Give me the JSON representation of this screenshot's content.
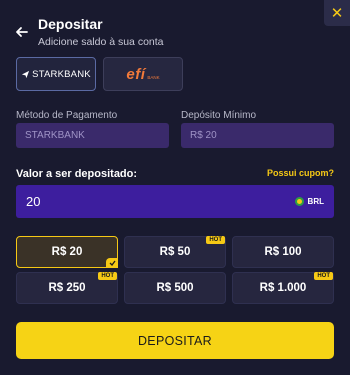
{
  "header": {
    "title": "Depositar",
    "subtitle": "Adicione saldo à sua conta",
    "close_label": "✕"
  },
  "methods": [
    {
      "name": "STARKBANK",
      "selected": true
    },
    {
      "name": "efí",
      "sub": "BANK",
      "selected": false
    }
  ],
  "payment": {
    "method_label": "Método de Pagamento",
    "method_value": "STARKBANK",
    "min_label": "Depósito Mínimo",
    "min_value": "R$ 20"
  },
  "amount": {
    "label": "Valor a ser depositado:",
    "coupon_link": "Possui cupom?",
    "value": "20",
    "currency": "BRL"
  },
  "presets": [
    {
      "label": "R$ 20",
      "hot": false,
      "selected": true
    },
    {
      "label": "R$ 50",
      "hot": true,
      "selected": false
    },
    {
      "label": "R$ 100",
      "hot": false,
      "selected": false
    },
    {
      "label": "R$ 250",
      "hot": true,
      "selected": false
    },
    {
      "label": "R$ 500",
      "hot": false,
      "selected": false
    },
    {
      "label": "R$ 1.000",
      "hot": true,
      "selected": false
    }
  ],
  "hot_label": "HOT",
  "submit_label": "DEPOSITAR",
  "colors": {
    "background": "#191a2f",
    "accent": "#f6c915",
    "field_purple": "#3a2a6b",
    "amount_purple": "#3d1e9e"
  }
}
